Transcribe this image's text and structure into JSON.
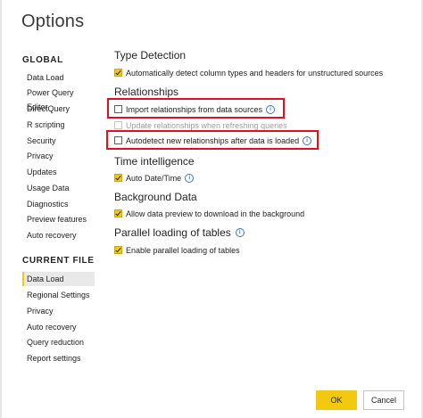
{
  "dialog": {
    "title": "Options"
  },
  "sidebar": {
    "global_header": "GLOBAL",
    "global_items": [
      "Data Load",
      "Power Query Editor",
      "DirectQuery",
      "R scripting",
      "Security",
      "Privacy",
      "Updates",
      "Usage Data",
      "Diagnostics",
      "Preview features",
      "Auto recovery"
    ],
    "current_header": "CURRENT FILE",
    "current_items": [
      "Data Load",
      "Regional Settings",
      "Privacy",
      "Auto recovery",
      "Query reduction",
      "Report settings"
    ],
    "active_item": "Data Load"
  },
  "content": {
    "type_detection": {
      "title": "Type Detection",
      "auto_detect": {
        "label": "Automatically detect column types and headers for unstructured sources",
        "checked": true
      }
    },
    "relationships": {
      "title": "Relationships",
      "import": {
        "label": "Import relationships from data sources",
        "checked": false,
        "info_icon": "info-icon"
      },
      "update": {
        "label": "Update relationships when refreshing queries",
        "checked": false,
        "disabled": true
      },
      "autodetect": {
        "label": "Autodetect new relationships after data is loaded",
        "checked": false,
        "info_icon": "info-icon"
      }
    },
    "time_intelligence": {
      "title": "Time intelligence",
      "auto_date": {
        "label": "Auto Date/Time",
        "checked": true,
        "info_icon": "info-icon"
      }
    },
    "background_data": {
      "title": "Background Data",
      "preview": {
        "label": "Allow data preview to download in the background",
        "checked": true
      }
    },
    "parallel": {
      "title": "Parallel loading of tables",
      "title_info_icon": "info-icon",
      "enable": {
        "label": "Enable parallel loading of tables",
        "checked": true
      }
    }
  },
  "footer": {
    "ok_label": "OK",
    "cancel_label": "Cancel"
  },
  "colors": {
    "accent": "#f2c811",
    "highlight": "#e3101c",
    "info": "#3a78c4"
  }
}
